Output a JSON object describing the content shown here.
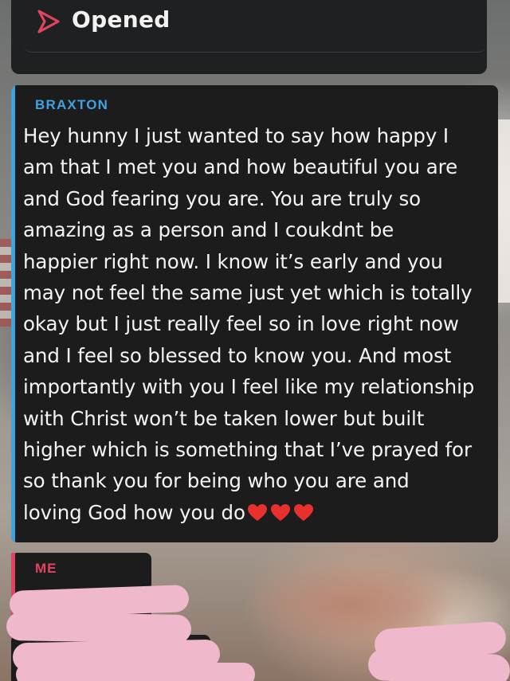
{
  "status": {
    "label": "Opened",
    "icon": "sent-arrow-icon",
    "icon_color": "#e0455f"
  },
  "message": {
    "sender": "BRAXTON",
    "sender_color": "#3fa3e0",
    "lines": [
      "Hey hunny I just wanted to say how happy I",
      "am that I met you and how beautiful you are",
      "and God fearing you are. You are truly so",
      "amazing as a person and I coukdnt be",
      "happier right now. I know it’s early and you",
      "may not feel the same just yet which is totally",
      "okay but I just really feel so in love right now",
      "and I feel so blessed to know you. And most",
      "importantly with you I feel like my relationship",
      "with Christ won’t be taken lower but built",
      "higher which is something that I’ve prayed for",
      "so thank you for being who you are and",
      "loving God how you do"
    ],
    "emoji": "❤️❤️❤️"
  },
  "reply": {
    "sender": "ME",
    "sender_color": "#e0455f"
  }
}
